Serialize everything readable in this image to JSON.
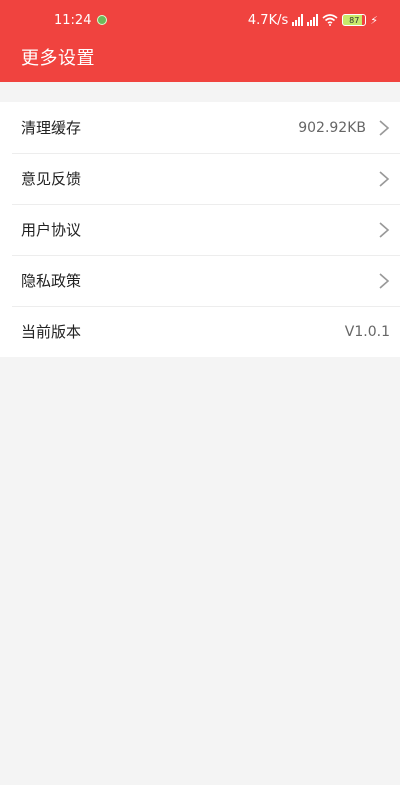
{
  "status_bar": {
    "time": "11:24",
    "speed": "4.7K/s",
    "signal1_tag": "HD",
    "signal2_tag": "HD",
    "battery": "87"
  },
  "header": {
    "title": "更多设置"
  },
  "settings": [
    {
      "label": "清理缓存",
      "value": "902.92KB",
      "chevron": true
    },
    {
      "label": "意见反馈",
      "value": "",
      "chevron": true
    },
    {
      "label": "用户协议",
      "value": "",
      "chevron": true
    },
    {
      "label": "隐私政策",
      "value": "",
      "chevron": true
    },
    {
      "label": "当前版本",
      "value": "V1.0.1",
      "chevron": false
    }
  ],
  "colors": {
    "header": "#f0433f",
    "background": "#f4f4f4"
  }
}
